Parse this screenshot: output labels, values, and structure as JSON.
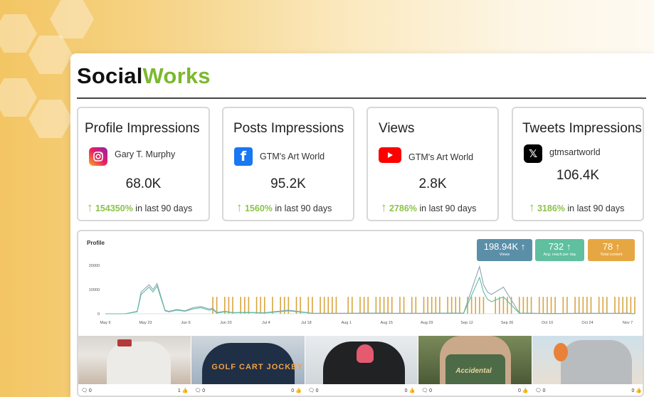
{
  "brand": {
    "part1": "Social",
    "part2": "Works"
  },
  "cards": [
    {
      "title": "Profile Impressions",
      "account": "Gary T. Murphy",
      "icon": "instagram-icon",
      "value": "68.0K",
      "pct": "154350%",
      "suffix": "in last 90 days"
    },
    {
      "title": "Posts Impressions",
      "account": "GTM's Art World",
      "icon": "facebook-icon",
      "value": "95.2K",
      "pct": "1560%",
      "suffix": "in last 90 days"
    },
    {
      "title": "Views",
      "account": "GTM's Art World",
      "icon": "youtube-icon",
      "value": "2.8K",
      "pct": "2786%",
      "suffix": "in last 90 days"
    },
    {
      "title": "Tweets Impressions",
      "account": "gtmsartworld",
      "icon": "x-icon",
      "value": "106.4K",
      "pct": "3186%",
      "suffix": "in last 90 days"
    }
  ],
  "chart": {
    "title": "Profile",
    "stats": [
      {
        "value": "198.94K",
        "label": "Views",
        "color": "#5b8fa8"
      },
      {
        "value": "732",
        "label": "Avg. reach per day",
        "color": "#5fbf9f"
      },
      {
        "value": "78",
        "label": "Total content",
        "color": "#e6a742"
      }
    ]
  },
  "chart_data": {
    "type": "line",
    "y_ticks": [
      "20000",
      "10000",
      "0"
    ],
    "ylim": [
      0,
      20000
    ],
    "x_labels": [
      "May 9",
      "May 23",
      "Jun 6",
      "Jun 20",
      "Jul 4",
      "Jul 18",
      "Aug 1",
      "Aug 15",
      "Aug 29",
      "Sep 12",
      "Sep 26",
      "Oct 10",
      "Oct 24",
      "Nov 7"
    ],
    "series": [
      {
        "color": "#8aa3b5",
        "x": [
          0,
          5,
          8,
          9,
          11,
          12,
          13,
          15,
          16,
          18,
          20,
          22,
          24,
          26,
          27,
          28,
          30,
          32,
          36,
          40,
          46,
          52,
          60,
          70,
          72,
          80,
          90,
          94,
          95,
          96,
          97,
          100,
          104,
          108,
          112,
          118,
          126,
          130,
          131,
          133
        ],
        "y": [
          0,
          0,
          1000,
          9000,
          12000,
          10000,
          12500,
          1500,
          1000,
          1800,
          1200,
          2500,
          3000,
          2000,
          2200,
          500,
          1000,
          500,
          600,
          400,
          1500,
          200,
          200,
          300,
          200,
          200,
          300,
          19500,
          12000,
          9000,
          8000,
          11000,
          300,
          200,
          100,
          200,
          200,
          200,
          300,
          0
        ]
      },
      {
        "color": "#5fbf9f",
        "x": [
          0,
          5,
          8,
          9,
          11,
          12,
          13,
          15,
          16,
          18,
          20,
          22,
          24,
          26,
          27,
          28,
          30,
          32,
          36,
          40,
          46,
          52,
          60,
          70,
          72,
          80,
          90,
          94,
          95,
          96,
          97,
          100,
          104,
          108,
          112,
          118,
          126,
          130,
          131,
          133
        ],
        "y": [
          0,
          0,
          800,
          8000,
          11000,
          9000,
          11500,
          1200,
          800,
          1500,
          1000,
          2000,
          2500,
          1500,
          1800,
          300,
          800,
          400,
          500,
          300,
          1200,
          150,
          150,
          200,
          150,
          150,
          200,
          15000,
          9000,
          6000,
          5000,
          7000,
          200,
          150,
          100,
          150,
          150,
          150,
          200,
          0
        ]
      }
    ],
    "bars": {
      "color": "#d9a441",
      "x": [
        27,
        28,
        30,
        31,
        32,
        34,
        35,
        36,
        38,
        39,
        40,
        42,
        44,
        45,
        46,
        48,
        49,
        51,
        52,
        54,
        55,
        56,
        57,
        58,
        61,
        62,
        64,
        65,
        66,
        68,
        69,
        70,
        71,
        72,
        74,
        75,
        77,
        78,
        80,
        81,
        82,
        83,
        84,
        86,
        87,
        88,
        89,
        91,
        92,
        93,
        94,
        95,
        98,
        99,
        100,
        101,
        102,
        104,
        105,
        106,
        107,
        109,
        110,
        111,
        112,
        113,
        115,
        116,
        118,
        119,
        120,
        121,
        122,
        124,
        125,
        126,
        128,
        129,
        130,
        131,
        132,
        133
      ],
      "y": [
        7000,
        7000,
        7000,
        7000,
        7000,
        7000,
        7000,
        7000,
        7000,
        7000,
        7000,
        7000,
        7000,
        7000,
        7000,
        7000,
        7000,
        7000,
        7000,
        7000,
        7000,
        7000,
        7000,
        7000,
        7000,
        7000,
        7000,
        7000,
        7000,
        7000,
        7000,
        7000,
        7000,
        7000,
        7000,
        7000,
        7000,
        7000,
        7000,
        7000,
        7000,
        7000,
        7000,
        7000,
        7000,
        7000,
        7000,
        7000,
        7000,
        7000,
        7000,
        7000,
        7000,
        7000,
        7000,
        7000,
        7000,
        7000,
        7000,
        7000,
        7000,
        7000,
        7000,
        7000,
        7000,
        7000,
        7000,
        7000,
        7000,
        7000,
        7000,
        7000,
        7000,
        7000,
        7000,
        7000,
        7000,
        7000,
        7000,
        7000,
        7000,
        7000
      ]
    }
  },
  "photos": [
    {
      "caption": "",
      "comments": "0",
      "likes": "1"
    },
    {
      "caption": "GOLF CART JOCKEY",
      "comments": "0",
      "likes": "0"
    },
    {
      "caption": "",
      "comments": "0",
      "likes": "0"
    },
    {
      "caption": "Accidental",
      "comments": "0",
      "likes": "0"
    },
    {
      "caption": "",
      "comments": "0",
      "likes": "0"
    }
  ]
}
